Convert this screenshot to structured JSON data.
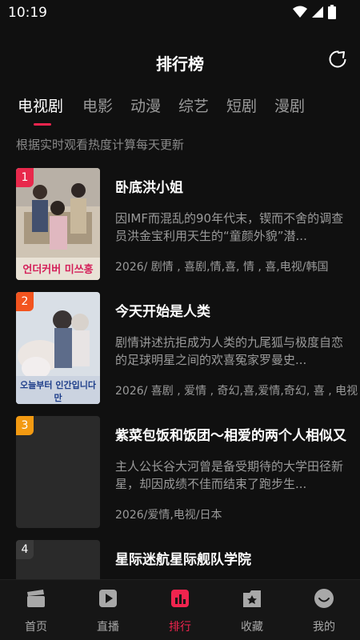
{
  "status": {
    "time": "10:19"
  },
  "header": {
    "title": "排行榜"
  },
  "tabs": [
    {
      "label": "电视剧",
      "active": true
    },
    {
      "label": "电影"
    },
    {
      "label": "动漫"
    },
    {
      "label": "综艺"
    },
    {
      "label": "短剧"
    },
    {
      "label": "漫剧"
    }
  ],
  "subtitle": "根据实时观看热度计算每天更新",
  "items": [
    {
      "rank": "1",
      "rank_color": "#e8294c",
      "title": "卧底洪小姐",
      "desc": "因IMF而混乱的90年代末，锲而不舍的调查员洪金宝利用天生的“童颜外貌”潜...",
      "meta": "2026/ 剧情 , 喜剧,情,喜, 情 , 喜,电视/韩国",
      "poster_text": "언더커버 미쓰홍"
    },
    {
      "rank": "2",
      "rank_color": "#f2541f",
      "title": "今天开始是人类",
      "desc": "剧情讲述抗拒成为人类的九尾狐与极度自恋的足球明星之间的欢喜冤家罗曼史...",
      "meta": "2026/ 喜剧 , 爱情 , 奇幻,喜,爱情,奇幻, 喜 , 电视",
      "poster_text": "오늘부터 인간입니다만"
    },
    {
      "rank": "3",
      "rank_color": "#f39a12",
      "title": "紫菜包饭和饭团～相爱的两个人相似又",
      "desc": "主人公长谷大河曾是备受期待的大学田径新星，却因成绩不佳而结束了跑步生...",
      "meta": "2026/爱情,电视/日本"
    },
    {
      "rank": "4",
      "rank_color": "#3a3a3a",
      "title": "星际迷航星际舰队学院"
    }
  ],
  "nav": [
    {
      "label": "首页",
      "icon": "clapperboard-icon"
    },
    {
      "label": "直播",
      "icon": "play-icon"
    },
    {
      "label": "排行",
      "icon": "chart-icon",
      "active": true
    },
    {
      "label": "收藏",
      "icon": "star-icon"
    },
    {
      "label": "我的",
      "icon": "smile-icon"
    }
  ],
  "colors": {
    "accent": "#f0244e",
    "background": "#101010"
  }
}
